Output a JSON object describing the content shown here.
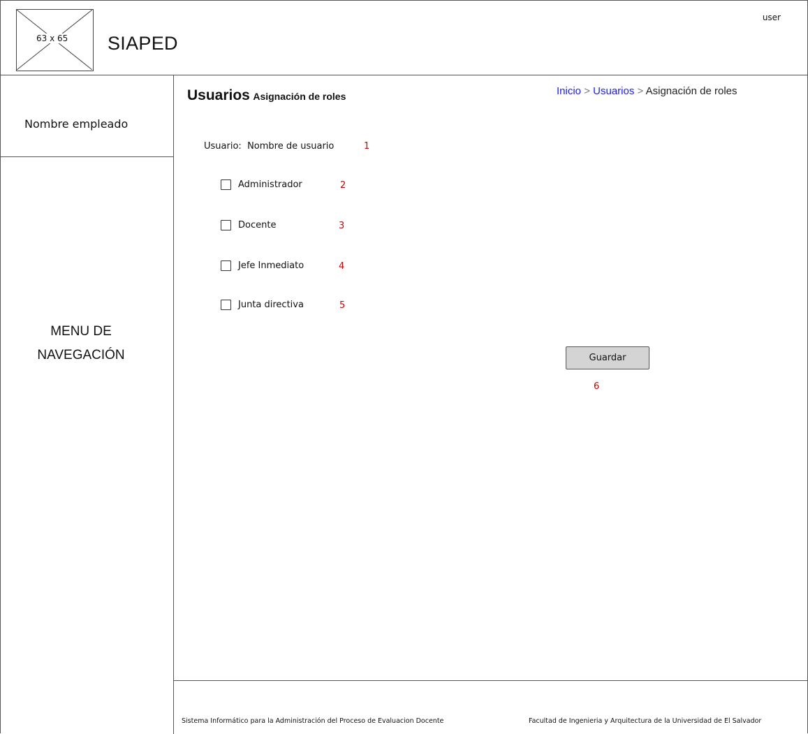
{
  "header": {
    "logo_placeholder": "63 x 65",
    "app_title": "SIAPED",
    "user": "user"
  },
  "sidebar": {
    "employee_name": "Nombre empleado",
    "menu_line1": "MENU DE",
    "menu_line2": "NAVEGACIÓN"
  },
  "page": {
    "title": "Usuarios",
    "subtitle": "Asignación de roles"
  },
  "breadcrumb": {
    "home": "Inicio",
    "users": "Usuarios",
    "current": "Asignación de roles",
    "separator": ">"
  },
  "form": {
    "user_label": "Usuario:",
    "user_value": "Nombre de usuario",
    "user_marker": "1",
    "roles": [
      {
        "label": "Administrador",
        "marker": "2",
        "checked": false
      },
      {
        "label": "Docente",
        "marker": "3",
        "checked": false
      },
      {
        "label": "Jefe Inmediato",
        "marker": "4",
        "checked": false
      },
      {
        "label": "Junta directiva",
        "marker": "5",
        "checked": false
      }
    ],
    "save_label": "Guardar",
    "save_marker": "6"
  },
  "footer": {
    "left": "Sistema Informático para la Administración del Proceso de Evaluacion Docente",
    "right": "Facultad de Ingenieria y Arquitectura de la Universidad de El Salvador"
  },
  "colors": {
    "marker": "#cc0000",
    "link": "#1a1aff",
    "button": "#d4d4d4"
  }
}
